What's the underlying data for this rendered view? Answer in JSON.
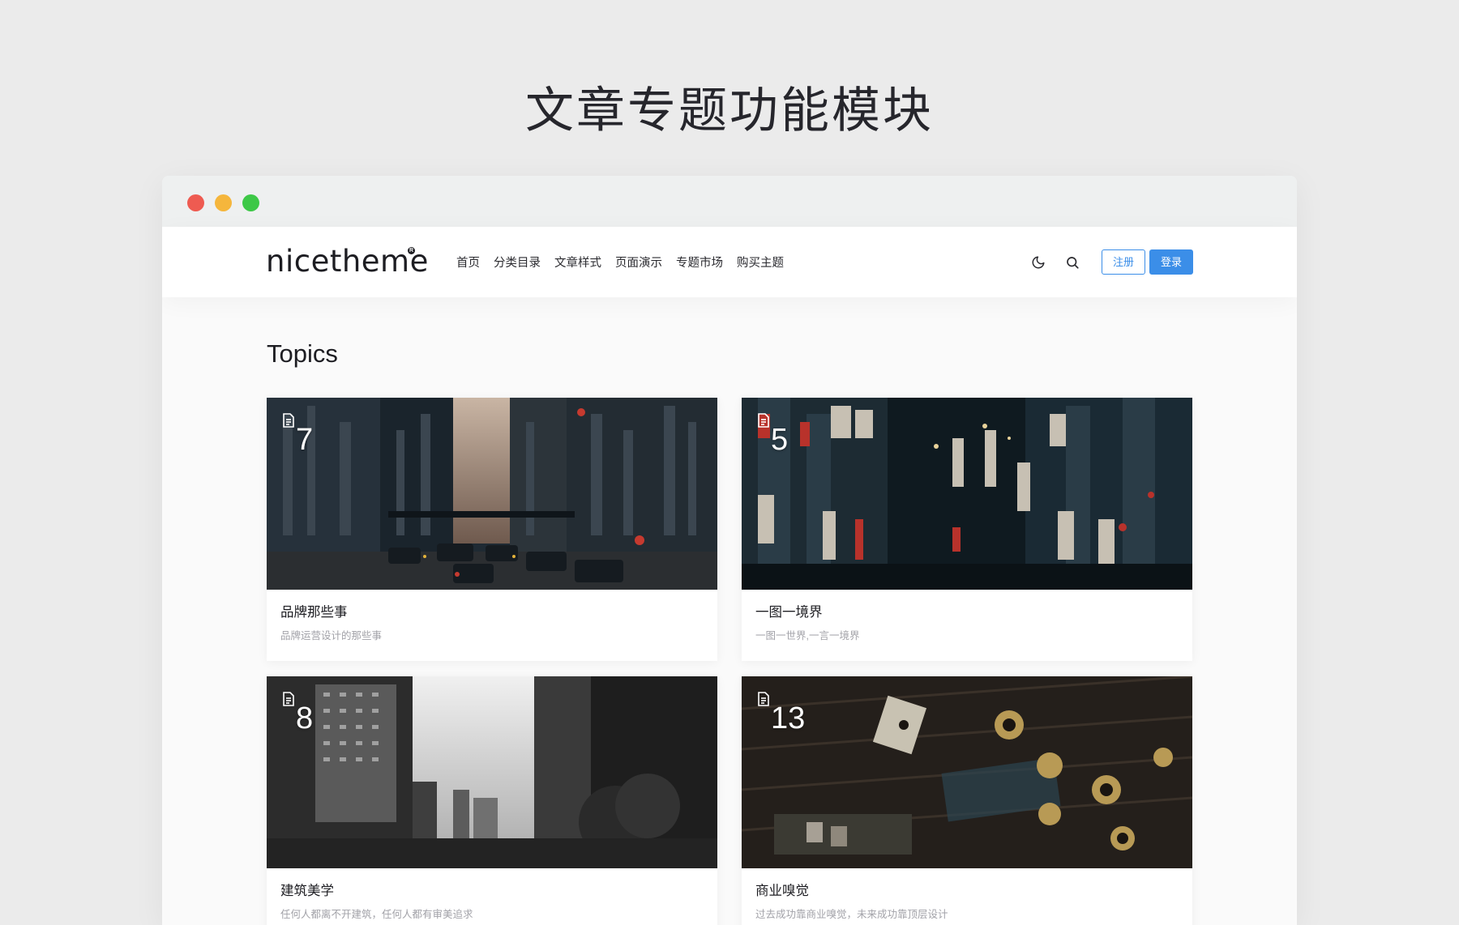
{
  "page": {
    "heading": "文章专题功能模块"
  },
  "header": {
    "logo": "nicetheme",
    "logo_mark": "R",
    "nav": [
      "首页",
      "分类目录",
      "文章样式",
      "页面演示",
      "专题市场",
      "购买主题"
    ],
    "register_label": "注册",
    "login_label": "登录",
    "icons": [
      "moon-icon",
      "search-icon"
    ]
  },
  "main": {
    "section_title": "Topics",
    "topics": [
      {
        "count": "7",
        "title": "品牌那些事",
        "desc": "品牌运营设计的那些事",
        "cover": "city-street-traffic"
      },
      {
        "count": "5",
        "title": "一图一境界",
        "desc": "一图一世界,一言一境界",
        "cover": "night-alley-neon"
      },
      {
        "count": "8",
        "title": "建筑美学",
        "desc": "任何人都离不开建筑，任何人都有审美追求",
        "cover": "bw-skyscrapers"
      },
      {
        "count": "13",
        "title": "商业嗅觉",
        "desc": "过去成功靠商业嗅觉，未来成功靠顶层设计",
        "cover": "cafe-tables-overhead"
      }
    ]
  },
  "colors": {
    "accent": "#3b8ee8",
    "window_red": "#ee5b51",
    "window_yellow": "#f5b63c",
    "window_green": "#3dc847"
  }
}
